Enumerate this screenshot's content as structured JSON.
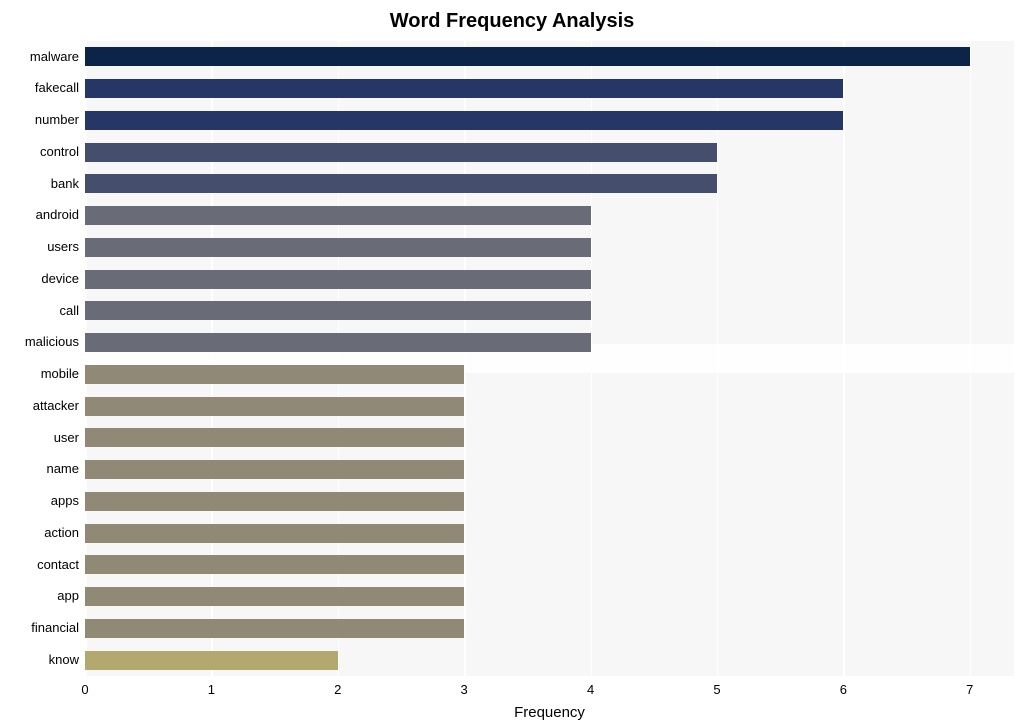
{
  "chart_data": {
    "type": "bar",
    "orientation": "horizontal",
    "title": "Word Frequency Analysis",
    "xlabel": "Frequency",
    "ylabel": "",
    "xlim": [
      0,
      7.35
    ],
    "xticks": [
      0,
      1,
      2,
      3,
      4,
      5,
      6,
      7
    ],
    "categories": [
      "malware",
      "fakecall",
      "number",
      "control",
      "bank",
      "android",
      "users",
      "device",
      "call",
      "malicious",
      "mobile",
      "attacker",
      "user",
      "name",
      "apps",
      "action",
      "contact",
      "app",
      "financial",
      "know"
    ],
    "values": [
      7,
      6,
      6,
      5,
      5,
      4,
      4,
      4,
      4,
      4,
      3,
      3,
      3,
      3,
      3,
      3,
      3,
      3,
      3,
      2
    ],
    "colors": [
      "#0b2447",
      "#253667",
      "#253667",
      "#454e6c",
      "#454e6c",
      "#696c77",
      "#696c77",
      "#696c77",
      "#696c77",
      "#696c77",
      "#8f8975",
      "#8f8975",
      "#8f8975",
      "#8f8975",
      "#8f8975",
      "#8f8975",
      "#8f8975",
      "#8f8975",
      "#8f8975",
      "#b3a96e"
    ]
  }
}
